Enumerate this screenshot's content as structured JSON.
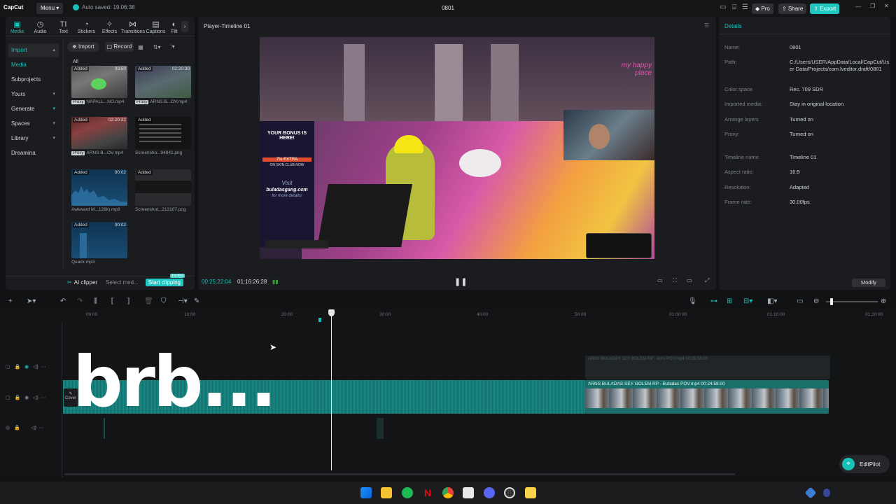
{
  "app": {
    "logo": "CapCut",
    "menu": "Menu",
    "autosave": "Auto saved: 19:06:38",
    "project": "0801"
  },
  "header_buttons": {
    "pro": "Pro",
    "share": "Share",
    "export": "Export"
  },
  "tools": [
    {
      "label": "Media",
      "icon": "media-icon"
    },
    {
      "label": "Audio",
      "icon": "audio-icon"
    },
    {
      "label": "Text",
      "icon": "text-icon"
    },
    {
      "label": "Stickers",
      "icon": "stickers-icon"
    },
    {
      "label": "Effects",
      "icon": "effects-icon"
    },
    {
      "label": "Transitions",
      "icon": "transitions-icon"
    },
    {
      "label": "Captions",
      "icon": "captions-icon"
    },
    {
      "label": "Filt",
      "icon": "filters-icon"
    }
  ],
  "sidenav": [
    "Import",
    "Media",
    "Subprojects",
    "Yours",
    "Generate",
    "Spaces",
    "Library",
    "Dreamina"
  ],
  "media_toolbar": {
    "import": "Import",
    "record": "Record",
    "filter_all": "All"
  },
  "media": [
    {
      "tag": "Added",
      "dur": "03:50",
      "name": "NAPALL...NO.mp4",
      "proxy": "Proxy"
    },
    {
      "tag": "Added",
      "dur": "02:20:30",
      "name": "ARNS B...OV.mp4",
      "proxy": "Proxy"
    },
    {
      "tag": "Added",
      "dur": "02:20:32",
      "name": "ARNS B...OV.mp4",
      "proxy": "Proxy"
    },
    {
      "tag": "Added",
      "dur": "",
      "name": "Screensho...94841.png",
      "proxy": ""
    },
    {
      "tag": "Added",
      "dur": "00:02",
      "name": "Awkward M...128k).mp3",
      "proxy": ""
    },
    {
      "tag": "Added",
      "dur": "",
      "name": "Screenshot...213107.png",
      "proxy": ""
    },
    {
      "tag": "Added",
      "dur": "00:02",
      "name": "Quack.mp3",
      "proxy": ""
    }
  ],
  "clipper": {
    "label": "AI clipper",
    "select": "Select med...",
    "start": "Start clipping",
    "badge": "Try free"
  },
  "player": {
    "title": "Player-Timeline 01",
    "current_time": "00:25:22:04",
    "total_time": "01:16:26:28",
    "overlay": {
      "ad_title": "YOUR BONUS IS HERE!",
      "ad_extra": "7% EXTRA",
      "ad_sub": "ON SKIN.CLUB NOW",
      "visit": "Visit",
      "site": "buladasgang.com",
      "more": "for more details!",
      "neon": "my happy place"
    }
  },
  "details": {
    "title": "Details",
    "rows": [
      {
        "k": "Name:",
        "v": "0801"
      },
      {
        "k": "Path:",
        "v": "C:/Users/USER/AppData/Local/CapCut/User Data/Projects/com.lveditor.draft/0801"
      },
      {
        "k": "Color space",
        "v": "Rec. 709 SDR"
      },
      {
        "k": "Imported media:",
        "v": "Stay in original location"
      },
      {
        "k": "Arrange layers",
        "v": "Turned on"
      },
      {
        "k": "Proxy:",
        "v": "Turned on"
      },
      {
        "k": "Timeline name",
        "v": "Timeline 01"
      },
      {
        "k": "Aspect ratio:",
        "v": "16:9"
      },
      {
        "k": "Resolution:",
        "v": "Adapted"
      },
      {
        "k": "Frame rate:",
        "v": "30.00fps"
      }
    ],
    "modify": "Modify"
  },
  "ruler": [
    "00:00",
    "10:00",
    "20:00",
    "30:00",
    "40:00",
    "50:00",
    "01:00:00",
    "01:10:00",
    "01:20:00"
  ],
  "clips": {
    "upper": "ARNS BULADAS SEY GOLEM RP - Arns POV.mp4  00:28:58:00",
    "main": "ARNS BULADAS SEY GOLEM RP - Buladas  POV.mp4  00:24:58:00",
    "cover": "Cover"
  },
  "brb": "brb...",
  "editpilot": "EditPilot",
  "colors": {
    "accent": "#18c1b8",
    "pro": "#2f3136",
    "export": "#20c7c0",
    "clip": "#1a6f6b"
  }
}
